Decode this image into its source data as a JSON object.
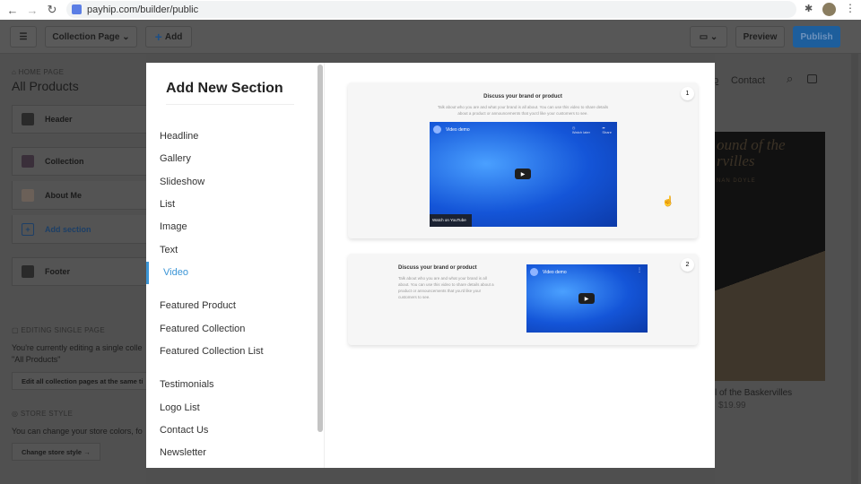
{
  "browser": {
    "url": "payhip.com/builder/public"
  },
  "toolbar": {
    "menu_icon": "hamburger-icon",
    "page_select": "Collection Page",
    "add": "Add",
    "device_icon": "desktop-icon",
    "preview": "Preview",
    "publish": "Publish",
    "publish_color": "#1d5e9c"
  },
  "sidebar": {
    "breadcrumb": "HOME PAGE",
    "title": "All Products",
    "items": [
      {
        "label": "Header"
      },
      {
        "label": "Collection"
      },
      {
        "label": "About Me"
      },
      {
        "label": "Add section"
      },
      {
        "label": "Footer"
      }
    ],
    "editing_heading": "EDITING SINGLE PAGE",
    "editing_text_1": "You're currently editing a single colle",
    "editing_text_2": "\"All Products\"",
    "edit_all_button": "Edit all collection pages at the same ti",
    "style_heading": "STORE STYLE",
    "style_text": "You can change your store colors, fo",
    "style_button": "Change store style →"
  },
  "modal": {
    "title": "Add New Section",
    "menu": [
      "Headline",
      "Gallery",
      "Slideshow",
      "List",
      "Image",
      "Text",
      "Video",
      "Featured Product",
      "Featured Collection",
      "Featured Collection List",
      "Testimonials",
      "Logo List",
      "Contact Us",
      "Newsletter"
    ],
    "active": "Video",
    "accent": "#3b95d6",
    "cards": [
      {
        "badge": "1",
        "title": "Discuss your brand or product",
        "desc": "Talk about who you are and what your brand is all about. You can use this video to share details about a product or announcements that you'd like your customers to see.",
        "video_title": "Video demo",
        "watch_later": "Watch later",
        "share": "Share",
        "watch_on": "Watch on YouTube"
      },
      {
        "badge": "2",
        "title": "Discuss your brand or product",
        "desc": "Talk about who you are and what your brand is all about. You can use this video to share details about a product or announcements that you'd like your customers to see.",
        "video_title": "Video demo"
      }
    ]
  },
  "store": {
    "nav_partial": "p",
    "nav_contact": "Contact",
    "product_title": "l of the Baskervilles",
    "product_price": "$19.99",
    "cover_title": "ound of the rvilles",
    "cover_author": "NAN DOYLE"
  }
}
